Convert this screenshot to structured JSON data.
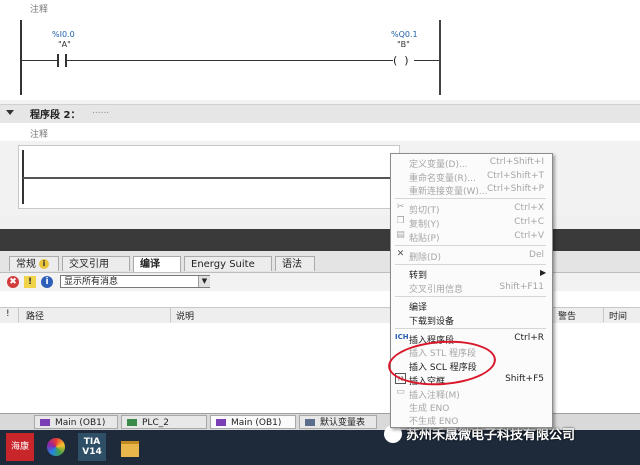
{
  "network1": {
    "comment": "注释",
    "contact": {
      "address": "%I0.0",
      "name": "\"A\""
    },
    "coil": {
      "address": "%Q0.1",
      "name": "\"B\""
    }
  },
  "network2": {
    "title": "程序段 2：",
    "dots": "......",
    "comment": "注释"
  },
  "inspector": {
    "tabs": [
      {
        "label": "常规",
        "icon": "info-icon"
      },
      {
        "label": "交叉引用"
      },
      {
        "label": "编译"
      },
      {
        "label": "Energy Suite"
      },
      {
        "label": "语法"
      }
    ],
    "active_tab": "编译",
    "filter_value": "显示所有消息",
    "columns": [
      "路径",
      "说明",
      "警告",
      "时间"
    ],
    "path_marker": "!"
  },
  "context_menu": {
    "items": [
      {
        "label": "定义变量(D)...",
        "shortcut": "Ctrl+Shift+I",
        "enabled": false
      },
      {
        "label": "重命名变量(R)...",
        "shortcut": "Ctrl+Shift+T",
        "enabled": false
      },
      {
        "label": "重新连接变量(W)...",
        "shortcut": "Ctrl+Shift+P",
        "enabled": false
      },
      {
        "label": "剪切(T)",
        "shortcut": "Ctrl+X",
        "enabled": false,
        "icon": "scissors-icon"
      },
      {
        "label": "复制(Y)",
        "shortcut": "Ctrl+C",
        "enabled": false,
        "icon": "copy-icon"
      },
      {
        "label": "粘贴(P)",
        "shortcut": "Ctrl+V",
        "enabled": false,
        "icon": "paste-icon"
      },
      {
        "label": "删除(D)",
        "shortcut": "Del",
        "enabled": false,
        "icon": "delete-icon"
      },
      {
        "label": "转到",
        "shortcut": "",
        "enabled": true,
        "submenu": true
      },
      {
        "label": "交叉引用信息",
        "shortcut": "Shift+F11",
        "enabled": false
      },
      {
        "label": "编译",
        "shortcut": "",
        "enabled": true
      },
      {
        "label": "下载到设备",
        "shortcut": "",
        "enabled": true
      },
      {
        "label": "插入程序段",
        "shortcut": "Ctrl+R",
        "enabled": true,
        "icon": "insert-network-icon"
      },
      {
        "label": "插入 STL 程序段",
        "shortcut": "",
        "enabled": false
      },
      {
        "label": "插入 SCL 程序段",
        "shortcut": "",
        "enabled": true
      },
      {
        "label": "插入空框",
        "shortcut": "Shift+F5",
        "enabled": true,
        "icon": "empty-box-icon"
      },
      {
        "label": "插入注释(M)",
        "shortcut": "",
        "enabled": false,
        "icon": "comment-icon"
      },
      {
        "label": "生成 ENO",
        "shortcut": "",
        "enabled": false
      },
      {
        "label": "不生成 ENO",
        "shortcut": "",
        "enabled": false
      }
    ]
  },
  "editor_tabs": [
    {
      "label": "Main (OB1)"
    },
    {
      "label": "PLC_2"
    },
    {
      "label": "Main (OB1)"
    },
    {
      "label": "默认变量表"
    }
  ],
  "taskbar": {
    "apps": [
      {
        "label": "海康",
        "icon": "app-red-icon"
      },
      {
        "label": "",
        "icon": "color-wheel-icon"
      },
      {
        "label": "TIA V14",
        "icon": "tia-portal-icon"
      },
      {
        "label": "",
        "icon": "folder-icon"
      }
    ],
    "watermark": "苏州禾晟微电子科技有限公司"
  },
  "colors": {
    "annotation_circle": "#d8182a",
    "address_blue": "#1f5fa8"
  }
}
